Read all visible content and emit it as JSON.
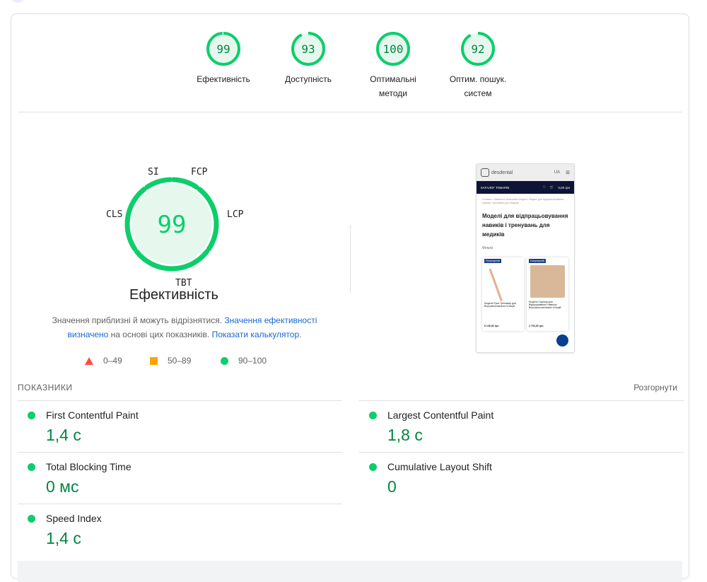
{
  "scores": [
    {
      "value": "99",
      "label": "Ефективність"
    },
    {
      "value": "93",
      "label": "Доступність"
    },
    {
      "value": "100",
      "label": "Оптимальні методи"
    },
    {
      "value": "92",
      "label": "Оптим. пошук. систем"
    }
  ],
  "gauge": {
    "score": "99",
    "title": "Ефективність",
    "labels": {
      "si": "SI",
      "fcp": "FCP",
      "lcp": "LCP",
      "tbt": "TBT",
      "cls": "CLS"
    }
  },
  "note": {
    "text1": "Значення приблизні й можуть відрізнятися. ",
    "link1": "Значення ефективності визначено",
    "text2": " на основі цих показників. ",
    "link2": "Показати калькулятор",
    "text3": "."
  },
  "legend": [
    {
      "range": "0–49"
    },
    {
      "range": "50–89"
    },
    {
      "range": "90–100"
    }
  ],
  "colors": {
    "pass": "#0cce6b",
    "average": "#ffa400",
    "fail": "#ff4e42",
    "passText": "#018642",
    "link": "#1967d2"
  },
  "thumbnail": {
    "logo": "desdental",
    "lang": "UA",
    "catalog": "КАТАЛОГ ТОВАРІВ",
    "cart": "0,00 грн",
    "breadcrumb": "Головна / Навчальні Анатомічні Моделі / Моделі для відпрацьовування навиків і тренувань для медиків",
    "title": "Моделі для відпрацьовування навиків і тренувань для медиків",
    "filter": "Фільтр",
    "products": [
      {
        "badge": "Популярний",
        "name": "Модель Рука Тренажер для Внутрішньовенних Ін'єкцій",
        "price": "6 145,00 грн."
      },
      {
        "badge": "Популярний",
        "name": "Модель Сідниця для Відпрацювання Навичок Внутрішньом'язових Ін'єкцій",
        "price": "2 700,00 грн."
      }
    ]
  },
  "metrics": {
    "heading": "ПОКАЗНИКИ",
    "expand": "Розгорнути",
    "items": [
      {
        "name": "First Contentful Paint",
        "value": "1,4 с"
      },
      {
        "name": "Largest Contentful Paint",
        "value": "1,8 с"
      },
      {
        "name": "Total Blocking Time",
        "value": "0 мс"
      },
      {
        "name": "Cumulative Layout Shift",
        "value": "0"
      },
      {
        "name": "Speed Index",
        "value": "1,4 с"
      }
    ]
  }
}
